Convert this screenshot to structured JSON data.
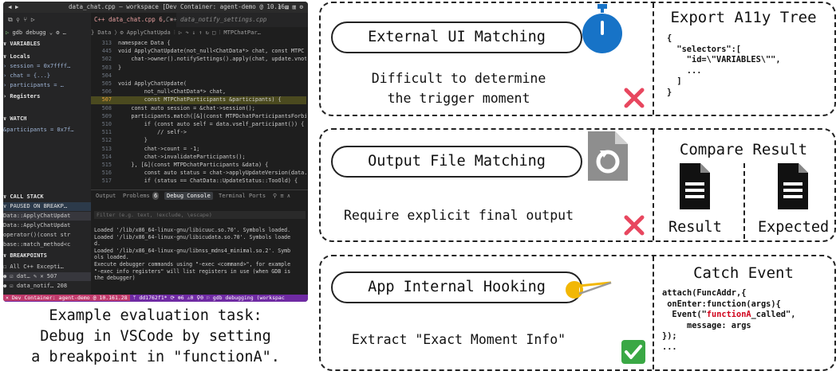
{
  "vscode": {
    "window_title": "data_chat.cpp — workspace [Dev Container: agent-demo @ 10.16…",
    "tabs": [
      {
        "label": "C++ data_chat.cpp 6, ×"
      },
      {
        "label": "C++ data_notify_settings.cpp"
      }
    ],
    "debug_config": "gdb debugg",
    "breadcrumbs": "} Data 〉⚙ ApplyChatUpda ⫶ ▷ ↷ ↓ ↑ ↻ □ ⫶ MTPChatPar…",
    "sidebar": [
      {
        "text": "∨ VARIABLES",
        "kind": "hdr"
      },
      {
        "text": " ∨ Locals",
        "kind": "hdr"
      },
      {
        "text": "   › session = 0x7ffff…",
        "kind": "dim"
      },
      {
        "text": "   › chat = {...}",
        "kind": "dim"
      },
      {
        "text": "   › participants = …",
        "kind": "dim"
      },
      {
        "text": " › Registers",
        "kind": "hdr"
      },
      {
        "text": "∨ WATCH",
        "kind": "hdr"
      },
      {
        "text": "   &participants = 0x7f…",
        "kind": "dim"
      },
      {
        "text": "∨ CALL STACK",
        "kind": "hdr"
      },
      {
        "text": " ∨ PAUSED ON BREAKP…",
        "kind": "paused"
      },
      {
        "text": "   Data::ApplyChatUpdat",
        "kind": "sel"
      },
      {
        "text": "   Data::ApplyChatUpdat",
        "kind": "norm"
      },
      {
        "text": "   operator()(const str",
        "kind": "norm"
      },
      {
        "text": "   base::match_method<c",
        "kind": "norm"
      },
      {
        "text": "∨ BREAKPOINTS",
        "kind": "hdr"
      },
      {
        "text": "  ☐ All C++ Excepti…",
        "kind": "norm"
      },
      {
        "text": "  ● ☑ dat…   ✎ ✕   507",
        "kind": "sel"
      },
      {
        "text": "  ● ☑ data_notif…    208",
        "kind": "norm"
      }
    ],
    "code_lines": [
      {
        "num": "313",
        "text": "namespace Data {"
      },
      {
        "num": "445",
        "text": "void ApplyChatUpdate(not_null<ChatData*> chat, const MTPC"
      },
      {
        "num": "502",
        "text": "    chat->owner().notifySettings().apply(chat, update.vnot"
      },
      {
        "num": "503",
        "text": "}"
      },
      {
        "num": "504",
        "text": ""
      },
      {
        "num": "505",
        "text": "void ApplyChatUpdate("
      },
      {
        "num": "506",
        "text": "        not_null<ChatData*> chat,"
      },
      {
        "num": "507",
        "text": "        const MTPChatParticipants &participants) {"
      },
      {
        "num": "508",
        "text": "    const auto session = &chat->session();"
      },
      {
        "num": "509",
        "text": "    participants.match([&](const MTPDchatParticipantsForbid"
      },
      {
        "num": "510",
        "text": "        if (const auto self = data.vself_participant()) {"
      },
      {
        "num": "511",
        "text": "            // self->"
      },
      {
        "num": "512",
        "text": "        }"
      },
      {
        "num": "513",
        "text": "        chat->count = -1;"
      },
      {
        "num": "514",
        "text": "        chat->invalidateParticipants();"
      },
      {
        "num": "515",
        "text": "    }, [&](const MTPDchatParticipants &data) {"
      },
      {
        "num": "516",
        "text": "        const auto status = chat->applyUpdateVersion(data.v"
      },
      {
        "num": "517",
        "text": "        if (status == ChatData::UpdateStatus::TooOld) {"
      }
    ],
    "panel_tabs": [
      "Output",
      "Problems",
      "6",
      "Debug Console",
      "Terminal",
      "Ports"
    ],
    "filter_placeholder": "Filter (e.g. text, !exclude, \\escape)",
    "console_lines": [
      "Loaded '/lib/x86_64-linux-gnu/libicuuc.so.70'. Symbols loaded.",
      "Loaded '/lib/x86_64-linux-gnu/libicudata.so.70'. Symbols loade",
      "d.",
      "Loaded '/lib/x86_64-linux-gnu/libnss_mdns4_minimal.so.2'. Symb",
      "ols loaded.",
      "Execute debugger commands using \"-exec <command>\", for example",
      "\"-exec info registers\" will list registers in use (when GDB is",
      "the debugger)"
    ],
    "status_remote": "⨯ Dev Container: agent-demo @ 10.161.28",
    "status_rest": "  ᛘ dd1762f1* ⟳  ⊗6 ⚠0  ⚲0  ⚐ gdb debugging (workspac"
  },
  "caption": {
    "lines": [
      "Example evaluation task:",
      "Debug in VSCode by setting",
      "a breakpoint in \"functionA\"."
    ]
  },
  "methods": [
    {
      "label": "External UI Matching",
      "desc": [
        "Difficult to determine",
        "the trigger moment"
      ],
      "result": "cross",
      "icon": "stopwatch-icon"
    },
    {
      "label": "Output File Matching",
      "desc": [
        "Require explicit final output"
      ],
      "result": "cross",
      "icon": "file-sync-icon"
    },
    {
      "label": "App Internal Hooking",
      "desc": [
        "Extract \"Exact Moment Info\""
      ],
      "result": "check",
      "icon": "safety-pin-icon"
    }
  ],
  "right_panels": {
    "a11y": {
      "title": "Export A11y Tree",
      "code": [
        "{",
        "  \"selectors\":[",
        "    \"id=\\\"VARIABLES\\\"\",",
        "    ...",
        "  ]",
        "}"
      ]
    },
    "compare": {
      "title": "Compare Result",
      "left_label": "Result",
      "right_label": "Expected"
    },
    "catch": {
      "title": "Catch Event",
      "code_pre": [
        "attach(FuncAddr,{",
        " onEnter:function(args){",
        "  Event(\""
      ],
      "code_red": "functionA",
      "code_mid": "_called\",",
      "code_post": [
        "     message: args",
        "});",
        "..."
      ]
    }
  },
  "colors": {
    "cross": "#e8475f",
    "check": "#3aa845",
    "stopwatch": "#1773c7",
    "pin": "#f2b705"
  }
}
